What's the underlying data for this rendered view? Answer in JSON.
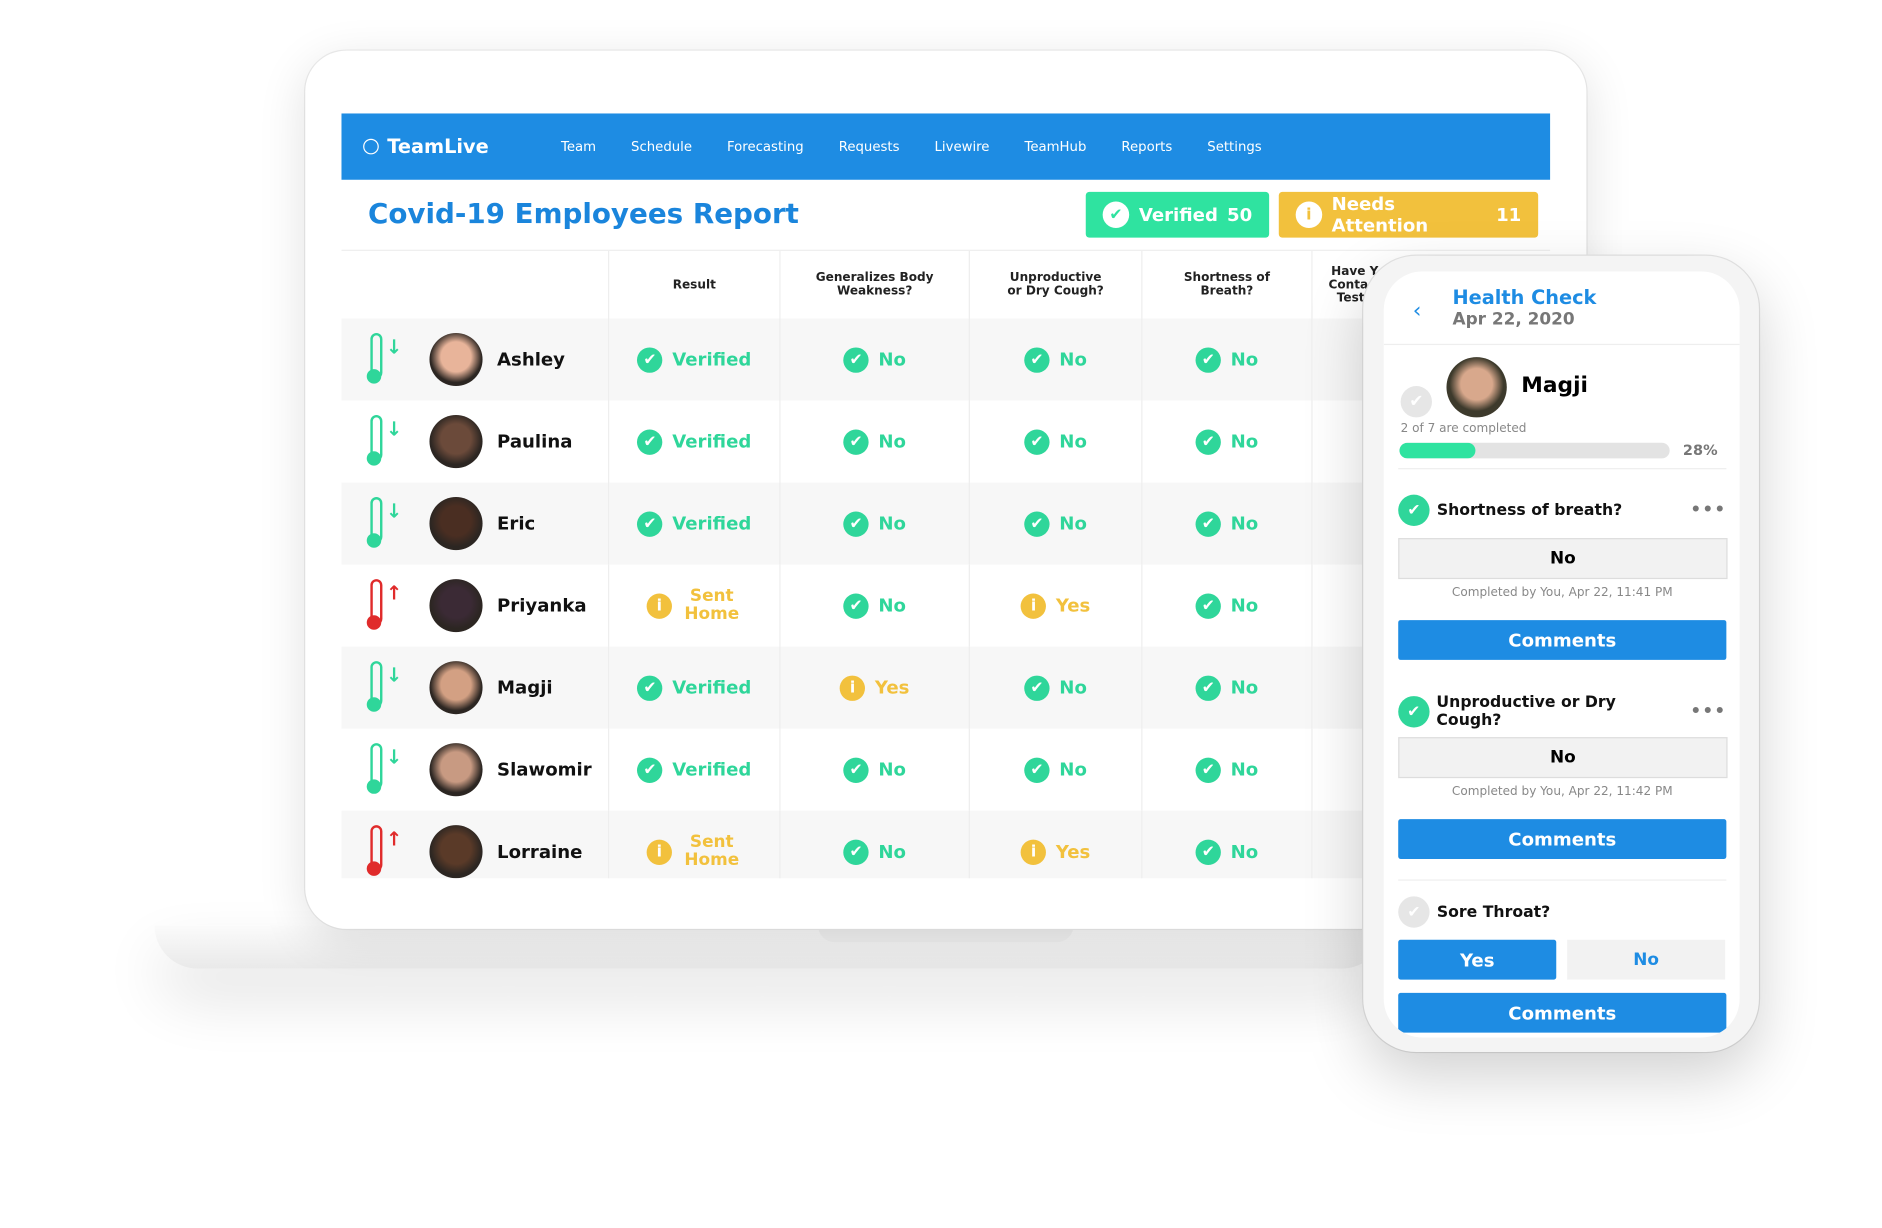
{
  "app": {
    "name": "TeamLive"
  },
  "nav": [
    "Team",
    "Schedule",
    "Forecasting",
    "Requests",
    "Livewire",
    "TeamHub",
    "Reports",
    "Settings"
  ],
  "page_title": "Covid-19 Employees Report",
  "badges": {
    "verified_label": "Verified",
    "verified_count": "50",
    "attention_label": "Needs Attention",
    "attention_count": "11"
  },
  "columns": [
    "Result",
    "Generalizes Body Weakness?",
    "Unproductive or Dry Cough?",
    "Shortness of Breath?",
    "Have Y… Contact… Teste…"
  ],
  "rows": [
    {
      "name": "Ashley",
      "temp": "down",
      "result": "Verified",
      "weakness": "No",
      "cough": "No",
      "breath": "No"
    },
    {
      "name": "Paulina",
      "temp": "down",
      "result": "Verified",
      "weakness": "No",
      "cough": "No",
      "breath": "No"
    },
    {
      "name": "Eric",
      "temp": "down",
      "result": "Verified",
      "weakness": "No",
      "cough": "No",
      "breath": "No"
    },
    {
      "name": "Priyanka",
      "temp": "up",
      "result": "Sent Home",
      "weakness": "No",
      "cough": "Yes",
      "breath": "No"
    },
    {
      "name": "Magji",
      "temp": "down",
      "result": "Verified",
      "weakness": "Yes",
      "cough": "No",
      "breath": "No"
    },
    {
      "name": "Slawomir",
      "temp": "down",
      "result": "Verified",
      "weakness": "No",
      "cough": "No",
      "breath": "No"
    },
    {
      "name": "Lorraine",
      "temp": "up",
      "result": "Sent Home",
      "weakness": "No",
      "cough": "Yes",
      "breath": "No"
    }
  ],
  "colors": {
    "brand": "#1e8ce3",
    "ok": "#2fd69a",
    "warn": "#f2c13d",
    "alert": "#e02b2b"
  },
  "phone": {
    "title": "Health Check",
    "date": "Apr 22, 2020",
    "employee": "Magji",
    "progress_text": "2 of 7 are completed",
    "progress_pct": 28,
    "progress_label": "28%",
    "questions": [
      {
        "label": "Shortness of breath?",
        "answer": "No",
        "completed": "Completed by You, Apr 22, 11:41 PM",
        "comments": "Comments"
      },
      {
        "label": "Unproductive or Dry Cough?",
        "answer": "No",
        "completed": "Completed by You, Apr 22, 11:42 PM",
        "comments": "Comments"
      },
      {
        "label": "Sore Throat?",
        "yes": "Yes",
        "no": "No",
        "comments": "Comments"
      }
    ]
  }
}
